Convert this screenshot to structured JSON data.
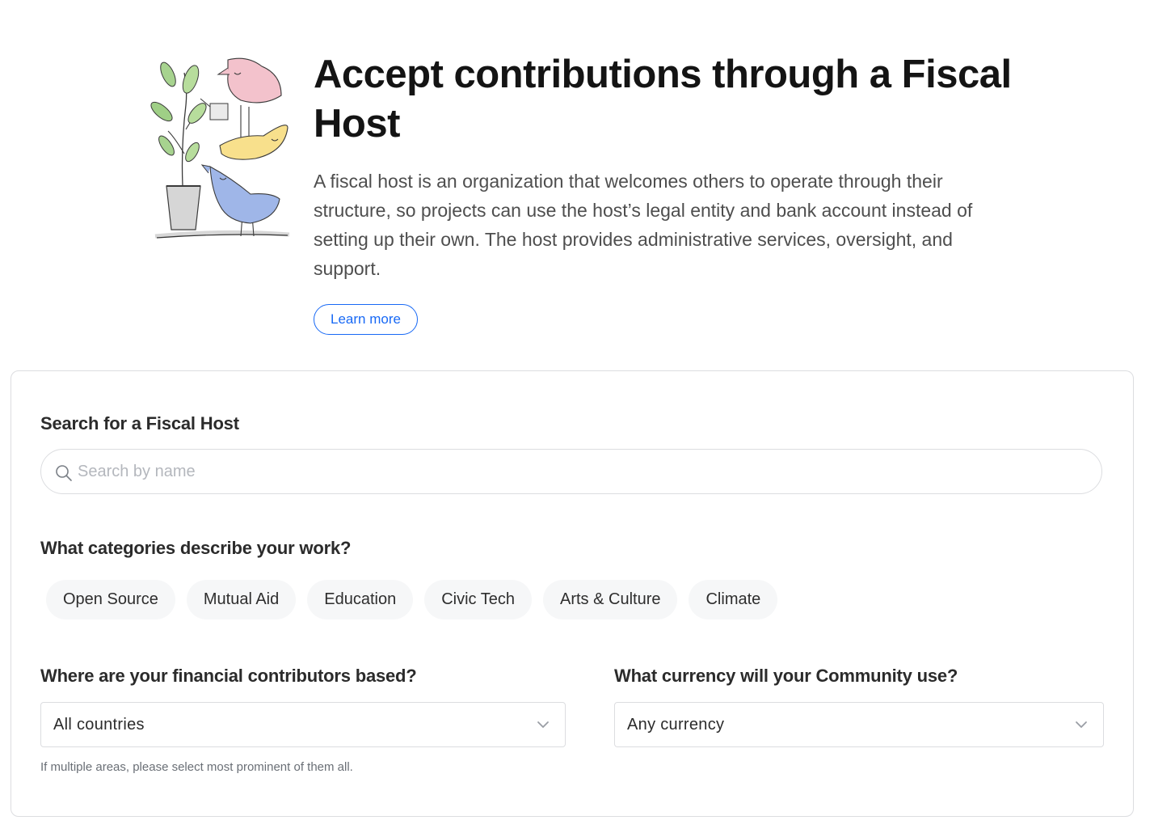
{
  "hero": {
    "title": "Accept contributions through a Fiscal Host",
    "description": "A fiscal host is an organization that welcomes others to operate through their structure, so projects can use the host’s legal entity and bank account instead of setting up their own. The host provides administrative services, oversight, and support.",
    "learn_more_label": "Learn more",
    "link_color": "#1869f5"
  },
  "search": {
    "label": "Search for a Fiscal Host",
    "placeholder": "Search by name",
    "icon": "search-icon"
  },
  "categories": {
    "label": "What categories describe your work?",
    "items": [
      "Open Source",
      "Mutual Aid",
      "Education",
      "Civic Tech",
      "Arts & Culture",
      "Climate"
    ]
  },
  "location": {
    "label": "Where are your financial contributors based?",
    "value": "All countries",
    "hint": "If multiple areas, please select most prominent of them all.",
    "icon": "chevron-down-icon"
  },
  "currency": {
    "label": "What currency will your Community use?",
    "value": "Any currency",
    "icon": "chevron-down-icon"
  }
}
